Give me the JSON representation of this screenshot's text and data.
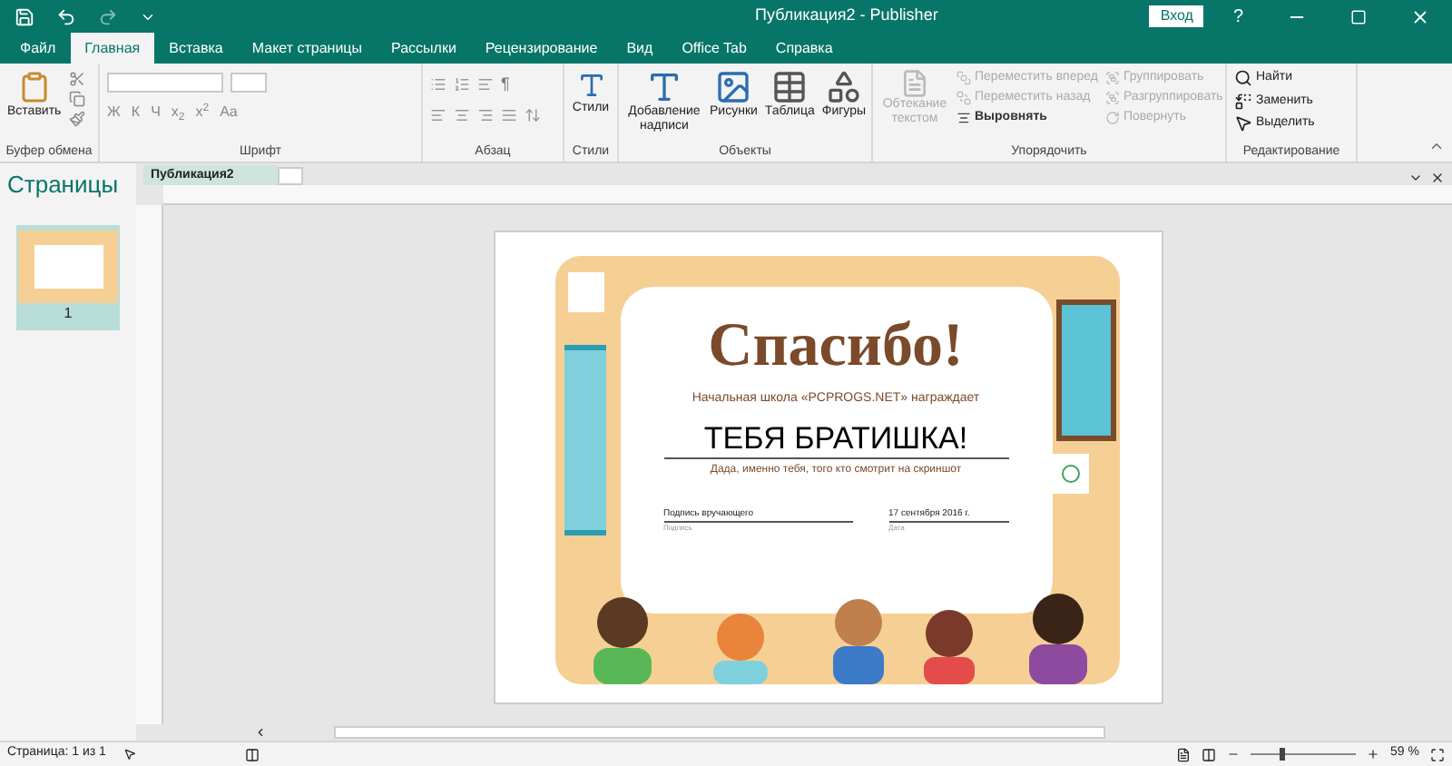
{
  "title_bar": {
    "title": "Публикация2 - Publisher",
    "sign_in": "Вход",
    "help": "?"
  },
  "tabs": [
    {
      "label": "Файл",
      "selected": false
    },
    {
      "label": "Главная",
      "selected": true
    },
    {
      "label": "Вставка",
      "selected": false
    },
    {
      "label": "Макет страницы",
      "selected": false
    },
    {
      "label": "Рассылки",
      "selected": false
    },
    {
      "label": "Рецензирование",
      "selected": false
    },
    {
      "label": "Вид",
      "selected": false
    },
    {
      "label": "Office Tab",
      "selected": false
    },
    {
      "label": "Справка",
      "selected": false
    }
  ],
  "ribbon": {
    "clipboard": {
      "label": "Буфер обмена",
      "paste": "Вставить"
    },
    "font": {
      "label": "Шрифт",
      "buttons": [
        "Ж",
        "К",
        "Ч",
        "x$_{2}$",
        "x$^{2}$",
        "Aa"
      ]
    },
    "paragraph": {
      "label": "Абзац",
      "pilcrow": "¶"
    },
    "styles": {
      "label": "Стили",
      "button": "Стили"
    },
    "objects": {
      "label": "Объекты",
      "buttons": [
        {
          "label": "Добавление надписи",
          "kind": "textbox"
        },
        {
          "label": "Рисунки",
          "kind": "picture"
        },
        {
          "label": "Таблица",
          "kind": "table"
        },
        {
          "label": "Фигуры",
          "kind": "shapes"
        }
      ]
    },
    "arrange": {
      "label": "Упорядочить",
      "wrap": {
        "label": "Обтекание текстом",
        "disabled": true
      },
      "items": [
        {
          "label": "Переместить вперед",
          "disabled": true
        },
        {
          "label": "Переместить назад",
          "disabled": true
        },
        {
          "label": "Выровнять",
          "disabled": false
        }
      ],
      "group_items": [
        {
          "label": "Группировать",
          "disabled": true
        },
        {
          "label": "Разгруппировать",
          "disabled": true
        },
        {
          "label": "Повернуть",
          "disabled": true
        }
      ]
    },
    "editing": {
      "label": "Редактирование",
      "items": [
        {
          "label": "Найти",
          "kind": "find"
        },
        {
          "label": "Заменить",
          "kind": "replace"
        },
        {
          "label": "Выделить",
          "kind": "select"
        }
      ]
    }
  },
  "pages_pane": {
    "title": "Страницы",
    "pages": [
      {
        "number": "1",
        "selected": true
      }
    ]
  },
  "document_tab": {
    "label": "Публикация2"
  },
  "certificate": {
    "title": "Спасибо!",
    "subtitle": "Начальная школа «PCPROGS.NET» награждает",
    "recipient": "ТЕБЯ БРАТИШКА!",
    "reason": "Дада, именно тебя, того кто смотрит на скриншот",
    "signature": "Подпись вручающего",
    "signature_caption": "Подпись",
    "date": "17 сентября 2016 г.",
    "date_caption": "Дата"
  },
  "status_bar": {
    "page": "Страница: 1 из 1",
    "zoom": "59 %",
    "zoom_slider": {
      "level": 0.3
    }
  }
}
